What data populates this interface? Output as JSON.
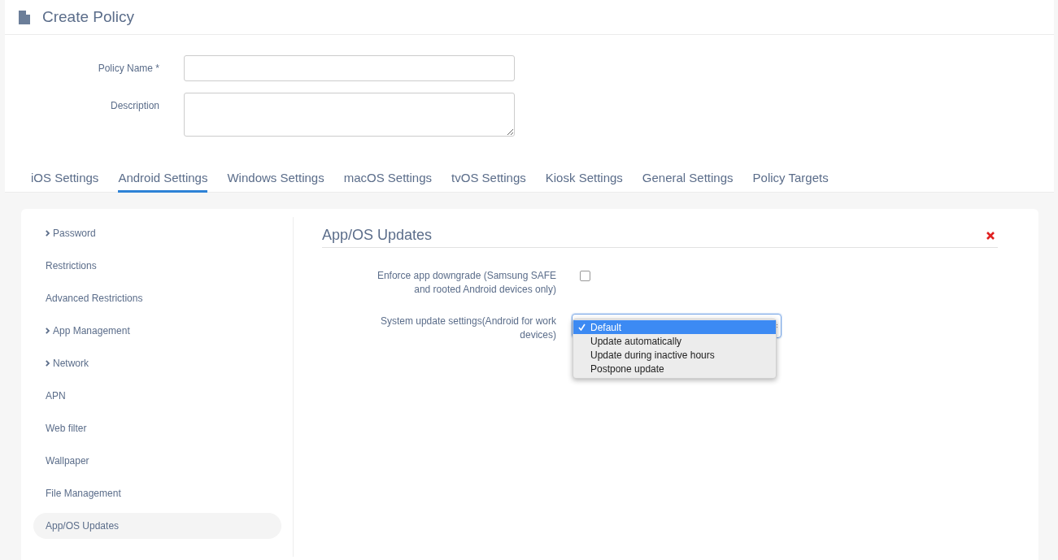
{
  "header": {
    "title": "Create Policy"
  },
  "form": [
    {
      "label": "Policy Name *",
      "kind": "text"
    },
    {
      "label": "Description",
      "kind": "textarea"
    }
  ],
  "tabs": [
    {
      "label": "iOS Settings",
      "selected": false
    },
    {
      "label": "Android Settings",
      "selected": true
    },
    {
      "label": "Windows Settings",
      "selected": false
    },
    {
      "label": "macOS Settings",
      "selected": false
    },
    {
      "label": "tvOS Settings",
      "selected": false
    },
    {
      "label": "Kiosk Settings",
      "selected": false
    },
    {
      "label": "General Settings",
      "selected": false
    },
    {
      "label": "Policy Targets",
      "selected": false
    }
  ],
  "sidebar": {
    "items": [
      {
        "label": "Password",
        "expandable": true,
        "selected": false
      },
      {
        "label": "Restrictions",
        "expandable": false,
        "selected": false
      },
      {
        "label": "Advanced Restrictions",
        "expandable": false,
        "selected": false
      },
      {
        "label": "App Management",
        "expandable": true,
        "selected": false
      },
      {
        "label": "Network",
        "expandable": true,
        "selected": false
      },
      {
        "label": "APN",
        "expandable": false,
        "selected": false
      },
      {
        "label": "Web filter",
        "expandable": false,
        "selected": false
      },
      {
        "label": "Wallpaper",
        "expandable": false,
        "selected": false
      },
      {
        "label": "File Management",
        "expandable": false,
        "selected": false
      },
      {
        "label": "App/OS Updates",
        "expandable": false,
        "selected": true
      }
    ]
  },
  "section": {
    "title": "App/OS Updates",
    "settings": [
      {
        "kind": "checkbox",
        "label": "Enforce app downgrade (Samsung SAFE and rooted Android devices only)",
        "checked": false
      },
      {
        "kind": "select",
        "label": "System update settings(Android for work devices)",
        "expanded": true,
        "options": [
          {
            "label": "Default",
            "selected": true
          },
          {
            "label": "Update automatically",
            "selected": false
          },
          {
            "label": "Update during inactive hours",
            "selected": false
          },
          {
            "label": "Postpone update",
            "selected": false
          }
        ]
      }
    ]
  }
}
